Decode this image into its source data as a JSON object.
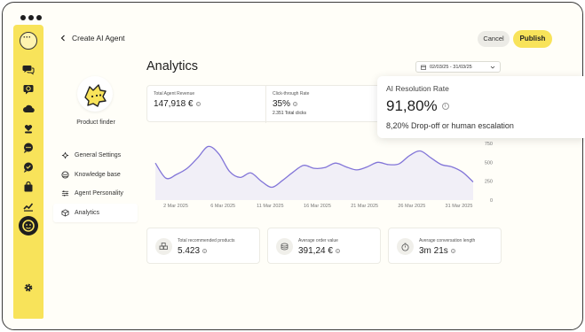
{
  "window": {
    "dots": 3
  },
  "header": {
    "back_label": "Create AI Agent",
    "cancel_label": "Cancel",
    "publish_label": "Publish"
  },
  "sidebar": {
    "items": [
      {
        "icon": "chat-bubbles-icon"
      },
      {
        "icon": "sync-chat-icon"
      },
      {
        "icon": "cloud-icon"
      },
      {
        "icon": "heart-hands-icon"
      },
      {
        "icon": "message-dots-icon"
      },
      {
        "icon": "message-check-icon"
      },
      {
        "icon": "shopping-bag-icon"
      },
      {
        "icon": "trend-chart-icon"
      },
      {
        "icon": "agent-face-icon",
        "active": true
      }
    ],
    "settings_icon": "gear-icon"
  },
  "agent": {
    "name": "Product finder"
  },
  "nav": {
    "items": [
      {
        "label": "General Settings",
        "icon": "sliders-icon"
      },
      {
        "label": "Knowledge base",
        "icon": "database-icon"
      },
      {
        "label": "Agent Personality",
        "icon": "tune-icon"
      },
      {
        "label": "Analytics",
        "icon": "cube-icon",
        "active": true
      }
    ]
  },
  "analytics": {
    "title": "Analytics",
    "date_range": "02/03/25 - 31/03/25",
    "metrics": [
      {
        "label": "Total Agent Revenue",
        "value": "147,918 €"
      },
      {
        "label": "Click-through Rate",
        "value": "35%",
        "sub": "2.351 Total clicks"
      }
    ],
    "popup": {
      "label": "AI Resolution Rate",
      "value": "91,80%",
      "sub": "8,20%  Drop-off or human escalation"
    },
    "stats": [
      {
        "label": "Total recommended products",
        "value": "5.423",
        "icon": "boxes-icon"
      },
      {
        "label": "Average order value",
        "value": "391,24 €",
        "icon": "coins-icon"
      },
      {
        "label": "Average conversation length",
        "value": "3m 21s",
        "icon": "stopwatch-icon"
      }
    ]
  },
  "chart_data": {
    "type": "line",
    "x_tick_labels": [
      "2 Mar 2025",
      "6 Mar 2025",
      "11 Mar 2025",
      "16 Mar 2025",
      "21 Mar 2025",
      "26 Mar 2025",
      "31 Mar 2025"
    ],
    "y_tick_labels": [
      "0",
      "250",
      "500",
      "750"
    ],
    "ylim": [
      0,
      750
    ],
    "x_days": [
      2,
      3,
      4,
      5,
      6,
      7,
      8,
      9,
      10,
      11,
      12,
      13,
      14,
      15,
      16,
      17,
      18,
      19,
      20,
      21,
      22,
      23,
      24,
      25,
      26,
      27,
      28,
      29,
      30,
      31,
      32
    ],
    "values": [
      490,
      290,
      340,
      420,
      560,
      710,
      610,
      380,
      300,
      360,
      250,
      170,
      260,
      370,
      460,
      420,
      430,
      490,
      440,
      400,
      440,
      500,
      470,
      480,
      590,
      650,
      560,
      470,
      440,
      370,
      240
    ],
    "line_color": "#8275d8",
    "fill_color": "#e8e5f6",
    "grid": false
  }
}
